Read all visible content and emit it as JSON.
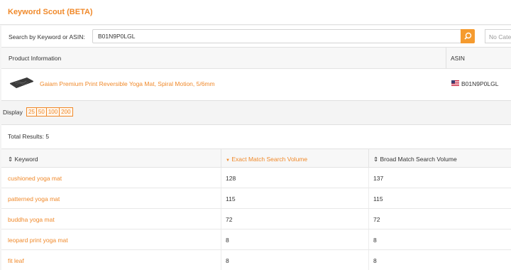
{
  "header": {
    "title": "Keyword Scout (BETA)"
  },
  "search": {
    "label": "Search by Keyword or ASIN:",
    "value": "B01N9P0LGL",
    "category_placeholder": "No Category"
  },
  "product_table": {
    "col_product": "Product Information",
    "col_asin": "ASIN",
    "product_name": "Gaiam Premium Print Reversible Yoga Mat, Spiral Motion, 5/6mm",
    "asin": "B01N9P0LGL"
  },
  "display": {
    "label": "Display",
    "options": [
      "25",
      "50",
      "100",
      "200"
    ]
  },
  "results": {
    "total_label": "Total Results: 5",
    "col_keyword": "Keyword",
    "col_exact": "Exact Match Search Volume",
    "col_broad": "Broad Match Search Volume",
    "rows": [
      {
        "keyword": "cushioned yoga mat",
        "exact": "128",
        "broad": "137"
      },
      {
        "keyword": "patterned yoga mat",
        "exact": "115",
        "broad": "115"
      },
      {
        "keyword": "buddha yoga mat",
        "exact": "72",
        "broad": "72"
      },
      {
        "keyword": "leopard print yoga mat",
        "exact": "8",
        "broad": "8"
      },
      {
        "keyword": "fit leaf",
        "exact": "8",
        "broad": "8"
      }
    ]
  },
  "colors": {
    "accent": "#f0892a"
  }
}
